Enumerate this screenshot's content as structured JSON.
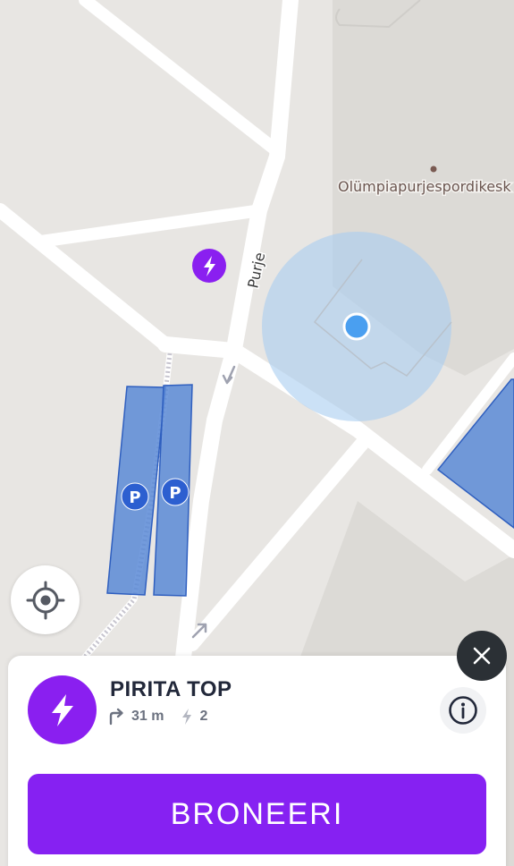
{
  "map": {
    "poi_label": "Olümpiapurjespordikesk",
    "street_label": "Purje",
    "parking_label": "P"
  },
  "colors": {
    "brand_purple": "#8a1ff0",
    "parking_blue": "#5b8ad6",
    "location_dot": "#4a9ff0",
    "close_dark": "#2b3035"
  },
  "icons": {
    "locate": "crosshair-icon",
    "close": "close-icon",
    "station": "lightning-icon",
    "distance": "turn-right-arrow-icon",
    "chargers": "lightning-icon",
    "info": "info-icon"
  },
  "station": {
    "name": "PIRITA TOP",
    "distance": "31 m",
    "chargers": "2"
  },
  "actions": {
    "book_label": "BRONEERI"
  }
}
